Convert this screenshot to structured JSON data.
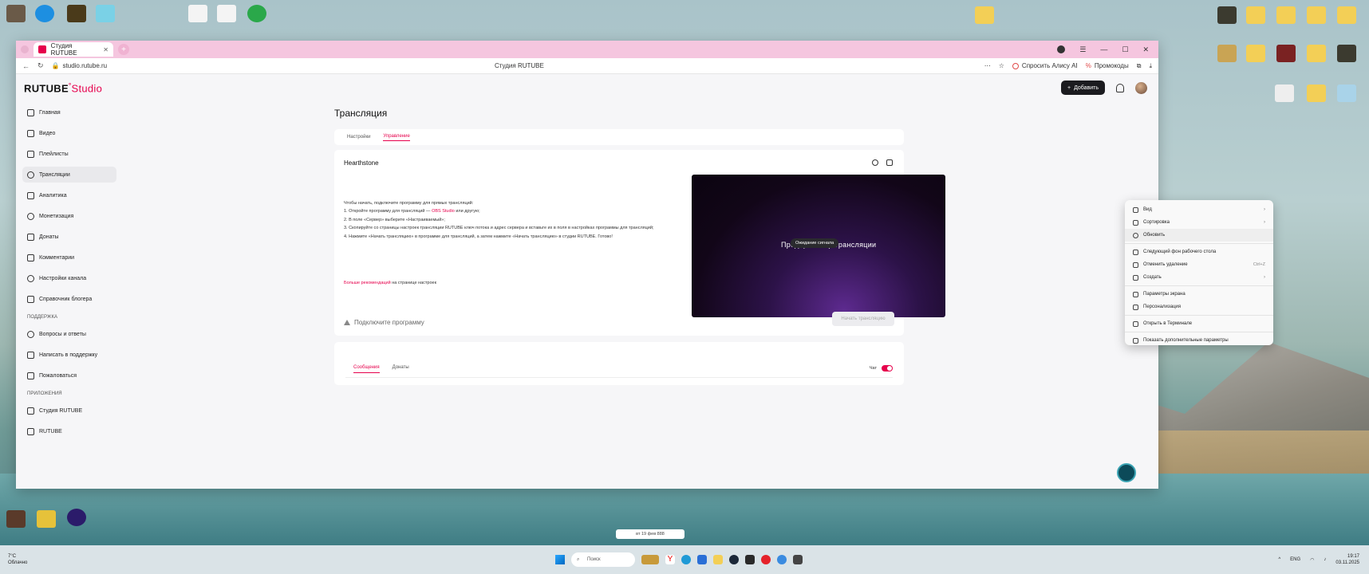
{
  "browser": {
    "tab_title": "Студия RUTUBE",
    "url": "studio.rutube.ru",
    "page_title_center": "Студия RUTUBE",
    "ask_alice": "Спросить Алису AI",
    "promocodes": "Промокоды"
  },
  "app": {
    "logo_main": "RUTUBE",
    "logo_studio": "Studio",
    "add_button": "Добавить",
    "sidebar": {
      "items": [
        {
          "label": "Главная",
          "icon": "home-icon"
        },
        {
          "label": "Видео",
          "icon": "video-icon"
        },
        {
          "label": "Плейлисты",
          "icon": "playlist-icon"
        },
        {
          "label": "Трансляции",
          "icon": "broadcast-icon",
          "active": true
        },
        {
          "label": "Аналитика",
          "icon": "analytics-icon"
        },
        {
          "label": "Монетизация",
          "icon": "monetization-icon"
        },
        {
          "label": "Донаты",
          "icon": "donate-icon"
        },
        {
          "label": "Комментарии",
          "icon": "comments-icon"
        },
        {
          "label": "Настройки канала",
          "icon": "settings-icon"
        },
        {
          "label": "Справочник блогера",
          "icon": "handbook-icon"
        }
      ],
      "support_title": "ПОДДЕРЖКА",
      "support_items": [
        {
          "label": "Вопросы и ответы",
          "icon": "faq-icon"
        },
        {
          "label": "Написать в поддержку",
          "icon": "mail-icon"
        },
        {
          "label": "Пожаловаться",
          "icon": "flag-icon"
        }
      ],
      "apps_title": "ПРИЛОЖЕНИЯ",
      "apps_items": [
        {
          "label": "Студия RUTUBE",
          "icon": "studio-app-icon"
        },
        {
          "label": "RUTUBE",
          "icon": "rutube-app-icon"
        }
      ]
    },
    "page_title": "Трансляция",
    "tabs": [
      "Настройки",
      "Управление"
    ],
    "active_tab": "Управление",
    "stream": {
      "title": "Hearthstone",
      "instructions_intro": "Чтобы начать, подключите программу для прямых трансляций:",
      "step1_prefix": "1. Откройте программу для трансляций —",
      "step1_link": "OBS Studio",
      "step1_suffix": "или другую;",
      "step2": "2. В поле «Сервер» выберите «Настраиваемый»;",
      "step3": "3. Скопируйте со страницы настроек трансляции RUTUBE ключ потока и адрес сервера и вставьте их в поля в настройках программы для трансляций;",
      "step4": "4. Нажмите «Начать трансляцию» в программе для трансляций, а затем нажмите «Начать трансляцию» в студии RUTUBE. Готово!",
      "more_link": "Больше рекомендаций",
      "more_suffix": "на странице настроек",
      "connect_label": "Подключите программу",
      "preview_text": "Предпросмотр трансляции",
      "waiting_badge": "Ожидание сигнала",
      "start_button": "Начать трансляцию"
    },
    "chat": {
      "tabs": [
        "Сообщения",
        "Донаты"
      ],
      "active_tab": "Сообщения",
      "toggle_label": "Чат"
    }
  },
  "context_menu": {
    "items": [
      {
        "label": "Вид",
        "icon": "grid-icon",
        "arrow": true
      },
      {
        "label": "Сортировка",
        "icon": "sort-icon",
        "arrow": true
      },
      {
        "label": "Обновить",
        "icon": "refresh-icon",
        "highlight": true
      },
      {
        "label": "Следующий фон рабочего стола",
        "icon": "wallpaper-icon"
      },
      {
        "label": "Отменить удаление",
        "icon": "undo-icon",
        "shortcut": "Ctrl+Z"
      },
      {
        "label": "Создать",
        "icon": "new-icon",
        "arrow": true
      },
      {
        "label": "Параметры экрана",
        "icon": "display-icon"
      },
      {
        "label": "Персонализация",
        "icon": "brush-icon"
      },
      {
        "label": "Открыть в Терминале",
        "icon": "terminal-icon"
      },
      {
        "label": "Показать дополнительные параметры",
        "icon": "more-icon"
      }
    ]
  },
  "taskbar": {
    "weather_temp": "7°C",
    "weather_desc": "Облачно",
    "search_placeholder": "Поиск",
    "lang": "ENG",
    "time": "19:17",
    "date": "03.11.2025"
  },
  "desktop": {
    "pip_text": "вт 19 фев 888"
  },
  "colors": {
    "accent": "#e6004c",
    "tab_strip": "#f5c6df",
    "preview_bg": "#120618"
  }
}
